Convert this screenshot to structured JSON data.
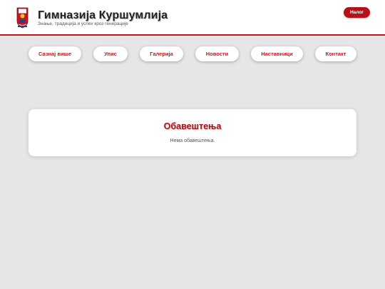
{
  "header": {
    "title": "Гимназија Куршумлија",
    "tagline": "Знање, традиција и успех кроз генерације",
    "account_label": "Налог"
  },
  "nav": {
    "items": [
      {
        "label": "Сазнај више"
      },
      {
        "label": "Упис"
      },
      {
        "label": "Галерија"
      },
      {
        "label": "Новости"
      },
      {
        "label": "Наставници"
      },
      {
        "label": "Контакт"
      }
    ]
  },
  "notices": {
    "title": "Обавештења",
    "empty_text": "Нема обавештења."
  },
  "colors": {
    "accent": "#c4161c",
    "accent_dark": "#b5111a",
    "background": "#e6e6e6"
  }
}
